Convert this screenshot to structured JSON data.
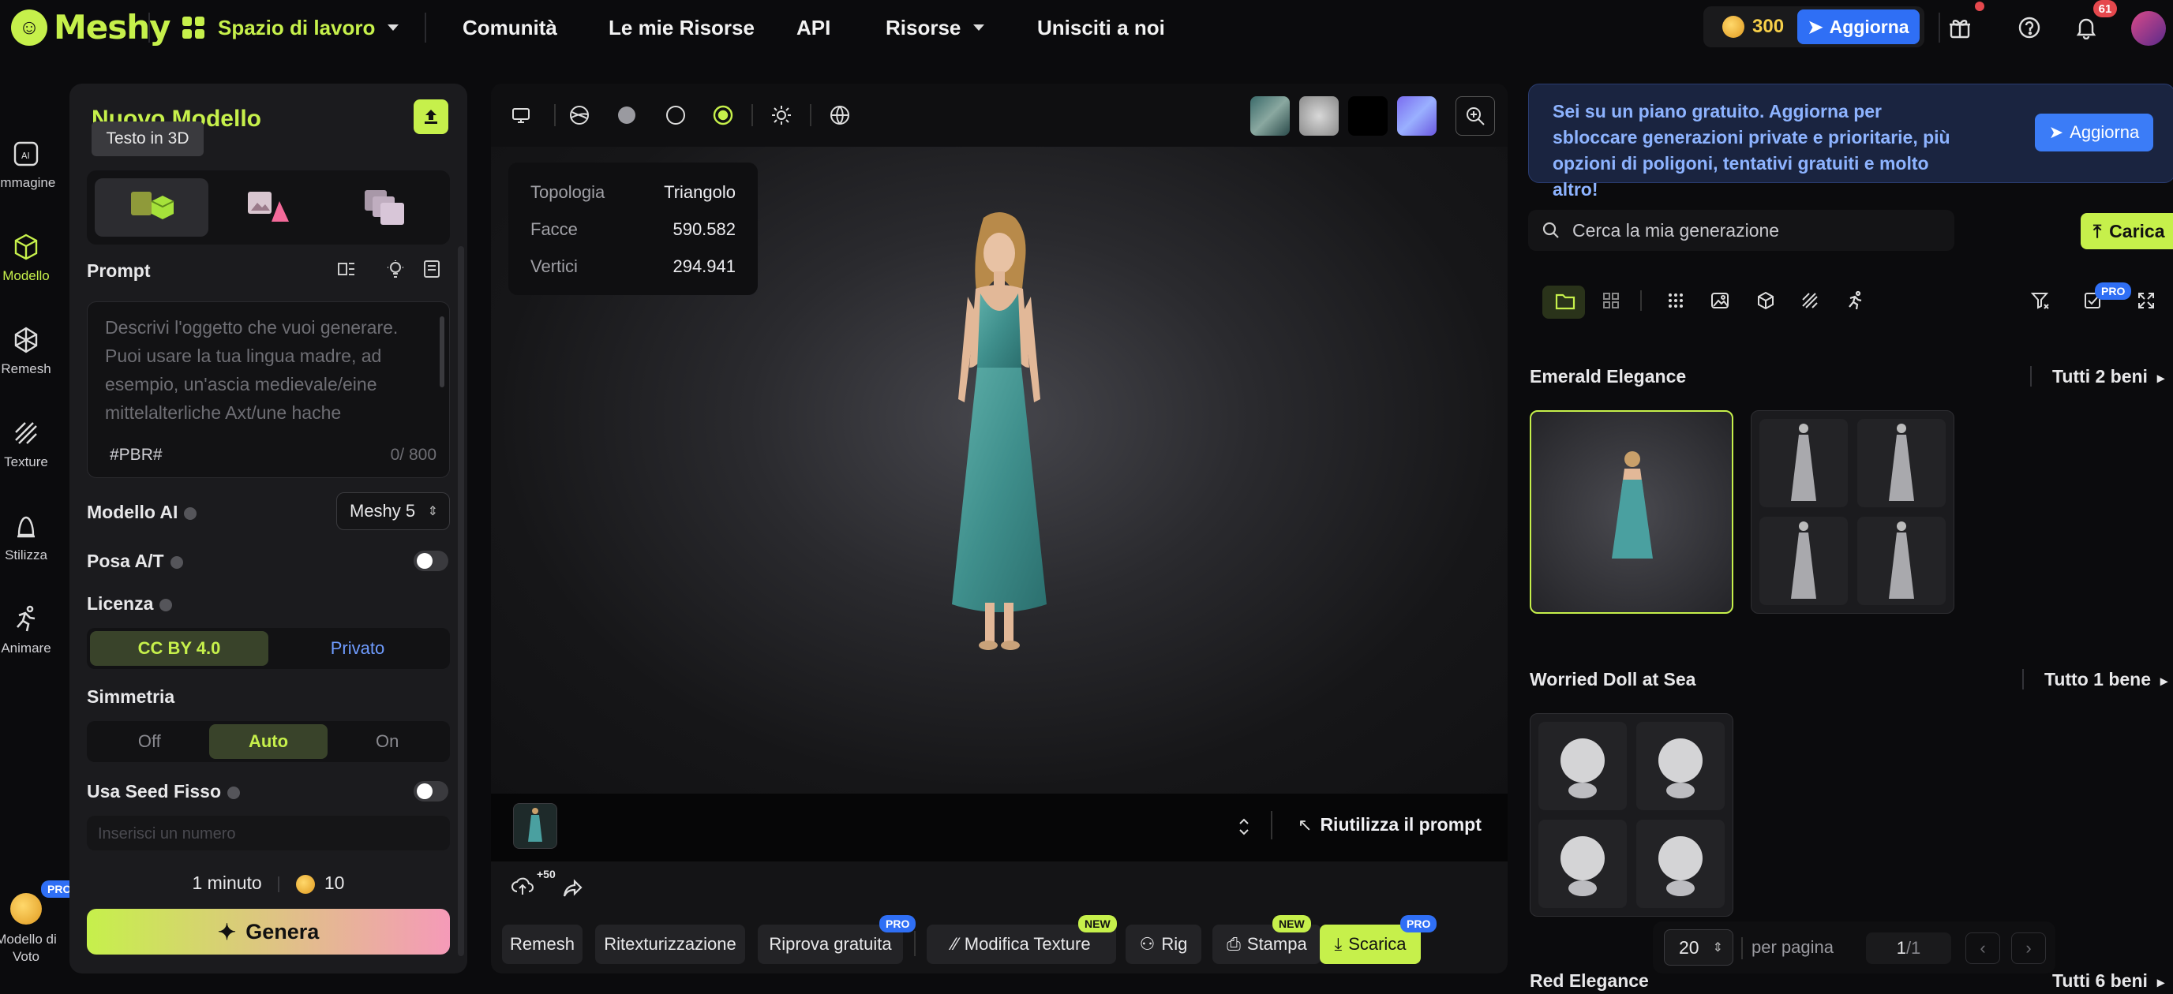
{
  "brand": {
    "name": "Meshy",
    "accent": "#c6f04b"
  },
  "topnav": {
    "workspace": "Spazio di lavoro",
    "community": "Comunità",
    "my_assets": "Le mie Risorse",
    "api": "API",
    "resources": "Risorse",
    "join": "Unisciti a noi",
    "credits": "300",
    "upgrade": "Aggiorna",
    "notifications": "61"
  },
  "rail": [
    {
      "label": "Immagine",
      "icon": "ai-image-icon"
    },
    {
      "label": "Modello",
      "icon": "cube-icon"
    },
    {
      "label": "Remesh",
      "icon": "remesh-icon"
    },
    {
      "label": "Texture",
      "icon": "texture-icon"
    },
    {
      "label": "Stilizza",
      "icon": "stylize-icon"
    },
    {
      "label": "Animare",
      "icon": "running-icon"
    },
    {
      "label": "Modello di Voto",
      "icon": "vote-icon",
      "badge": "PRO"
    }
  ],
  "panel": {
    "title": "Nuovo Modello",
    "tooltip": "Testo in 3D",
    "prompt_label": "Prompt",
    "prompt_placeholder": "Descrivi l'oggetto che vuoi generare. Puoi usare la tua lingua madre, ad esempio, un'ascia medievale/eine mittelalterliche Axt/une hache",
    "tag": "#PBR#",
    "counter": "0/ 800",
    "ai_model_label": "Modello AI",
    "ai_model_value": "Meshy 5",
    "pose_label": "Posa A/T",
    "license_label": "Licenza",
    "license_options": [
      "CC BY 4.0",
      "Privato"
    ],
    "symmetry_label": "Simmetria",
    "symmetry_options": [
      "Off",
      "Auto",
      "On"
    ],
    "seed_label": "Usa Seed Fisso",
    "seed_placeholder": "Inserisci un numero",
    "time": "1 minuto",
    "cost": "10",
    "generate": "Genera"
  },
  "viewer": {
    "stats": [
      {
        "k": "Topologia",
        "v": "Triangolo"
      },
      {
        "k": "Facce",
        "v": "590.582"
      },
      {
        "k": "Vertici",
        "v": "294.941"
      }
    ],
    "reuse_prompt": "Riutilizza il prompt",
    "plus_badge": "+50",
    "actions": [
      "Remesh",
      "Ritexturizzazione",
      "Riprova gratuita",
      "Modifica Texture",
      "Rig",
      "Stampa",
      "Scarica"
    ],
    "badges": {
      "pro": "PRO",
      "new": "NEW"
    }
  },
  "right": {
    "notice": "Sei su un piano gratuito. Aggiorna per sbloccare generazioni private e prioritarie, più opzioni di poligoni, tentativi gratuiti e molto altro!",
    "upgrade": "Aggiorna",
    "search_placeholder": "Cerca la mia generazione",
    "upload": "Carica",
    "pro_badge": "PRO",
    "sections": [
      {
        "title": "Emerald Elegance",
        "link": "Tutti 2 beni"
      },
      {
        "title": "Worried Doll at Sea",
        "link": "Tutto 1 bene"
      },
      {
        "title": "Red Elegance",
        "link": "Tutti 6 beni"
      }
    ],
    "pager": {
      "size": "20",
      "per_page": "per pagina",
      "page": "1",
      "total": "/1"
    }
  }
}
